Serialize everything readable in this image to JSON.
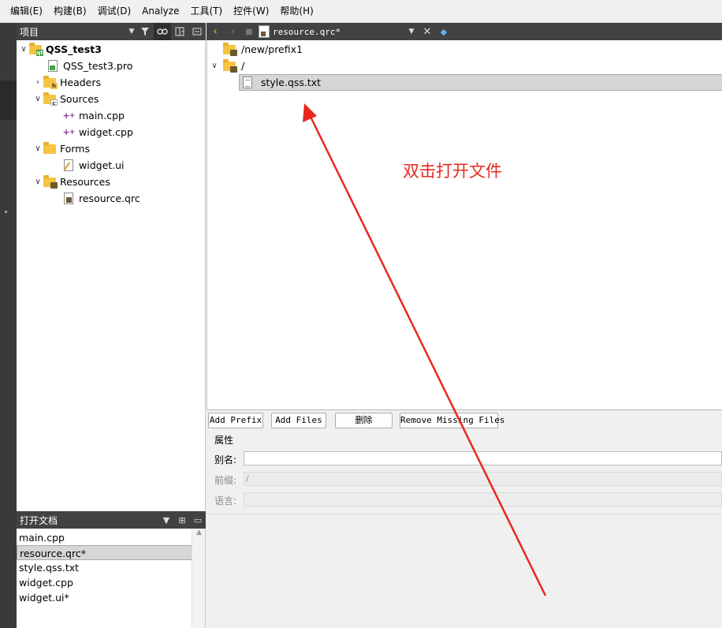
{
  "menu": [
    "编辑(E)",
    "构建(B)",
    "调试(D)",
    "Analyze",
    "工具(T)",
    "控件(W)",
    "帮助(H)"
  ],
  "project_pane": {
    "title": "项目"
  },
  "tree": {
    "project": "QSS_test3",
    "pro_file": "QSS_test3.pro",
    "headers": "Headers",
    "sources": "Sources",
    "main_cpp": "main.cpp",
    "widget_cpp": "widget.cpp",
    "forms": "Forms",
    "widget_ui": "widget.ui",
    "resources": "Resources",
    "resource_qrc": "resource.qrc"
  },
  "open_docs": {
    "title": "打开文档",
    "items": [
      "main.cpp",
      "resource.qrc*",
      "style.qss.txt",
      "widget.cpp",
      "widget.ui*"
    ]
  },
  "editor": {
    "file_name": "resource.qrc*"
  },
  "resource_tree": {
    "prefix1": "/new/prefix1",
    "root_prefix": "/",
    "file": "style.qss.txt"
  },
  "annotation": {
    "text": "双击打开文件",
    "color": "#e8281e"
  },
  "buttons": {
    "add_prefix": "Add Prefix",
    "add_files": "Add Files",
    "delete": "删除",
    "remove_missing": "Remove Missing Files"
  },
  "properties": {
    "group": "属性",
    "alias_label": "别名:",
    "alias_value": "",
    "prefix_label": "前缀:",
    "prefix_value": "/",
    "lang_label": "语言:",
    "lang_value": ""
  }
}
